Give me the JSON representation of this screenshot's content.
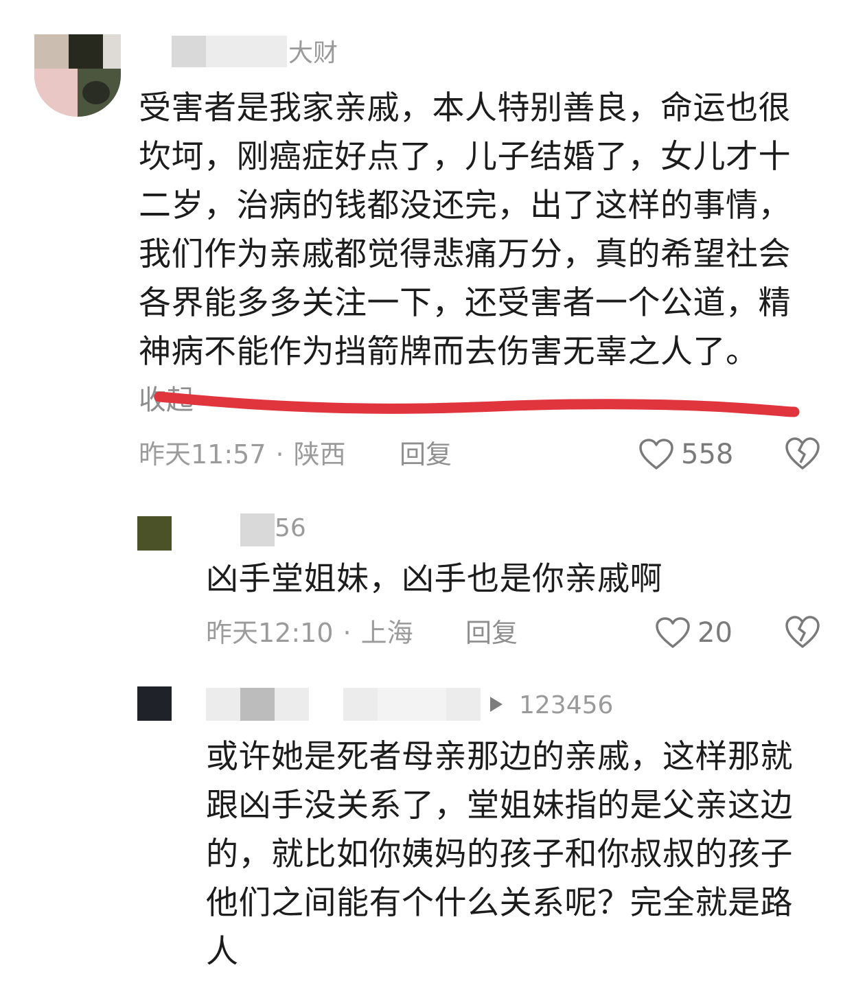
{
  "comments": [
    {
      "username_visible": "大财",
      "body_lines": [
        "受害者是我家亲戚，本人特别善良，命运也很",
        "坎坷，刚癌症好点了，儿子结婚了，女儿才十",
        "二岁，治病的钱都没还完，出了这样的事情，",
        "我们作为亲戚都觉得悲痛万分，真的希望社会",
        "各界能多多关注一下，还受害者一个公道，精",
        "神病不能作为挡箭牌而去伤害无辜之人了。"
      ],
      "collapse_label": "收起",
      "time": "昨天11:57",
      "separator": "·",
      "location": "陕西",
      "reply_label": "回复",
      "likes": "558"
    },
    {
      "username_visible": "56",
      "body_lines": [
        "凶手堂姐妹，凶手也是你亲戚啊"
      ],
      "time": "昨天12:10",
      "separator": "·",
      "location": "上海",
      "reply_label": "回复",
      "likes": "20"
    },
    {
      "username_visible": "123456",
      "body_lines": [
        "或许她是死者母亲那边的亲戚，这样那就",
        "跟凶手没关系了，堂姐妹指的是父亲这边",
        "的，就比如你姨妈的孩子和你叔叔的孩子",
        "他们之间能有个什么关系呢？完全就是路",
        "人"
      ]
    }
  ],
  "colors": {
    "annotation_red": "#e0353d",
    "meta_gray": "#9b9b9b",
    "text": "#1c1c1c"
  },
  "icons": {
    "like": "heart-outline-icon",
    "dislike": "broken-heart-icon",
    "reply_arrow": "play-triangle-icon"
  }
}
